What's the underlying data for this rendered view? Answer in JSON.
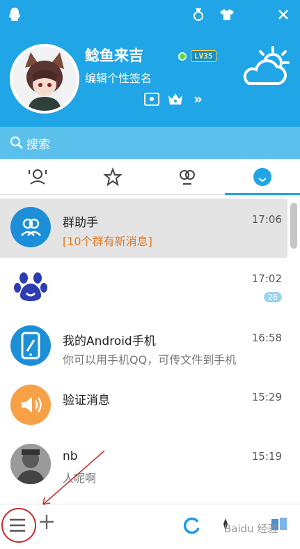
{
  "header": {
    "nickname": "鲶鱼来吉",
    "level": "LV35",
    "signature": "编辑个性签名",
    "search_placeholder": "搜索",
    "bg_color": "#20a5e6"
  },
  "tabs": [
    {
      "icon": "contact-icon"
    },
    {
      "icon": "star-icon"
    },
    {
      "icon": "group-icon"
    },
    {
      "icon": "message-icon",
      "active": true
    }
  ],
  "conversations": [
    {
      "name": "群助手",
      "message": "[10个群有新消息]",
      "time": "17:06",
      "icon": "group-assistant-icon",
      "selected": true
    },
    {
      "name": "",
      "message": "",
      "time": "17:02",
      "badge": "26",
      "icon": "paw-icon"
    },
    {
      "name": "我的Android手机",
      "message": "你可以用手机QQ，可传文件到手机",
      "time": "16:58",
      "icon": "phone-icon"
    },
    {
      "name": "验证消息",
      "message": "",
      "time": "15:29",
      "icon": "notification-icon"
    },
    {
      "name": "nb",
      "message": "人呢啊",
      "time": "15:19",
      "icon": "user-avatar"
    }
  ],
  "bottombar": {
    "watermark": "Baidu 经验"
  }
}
